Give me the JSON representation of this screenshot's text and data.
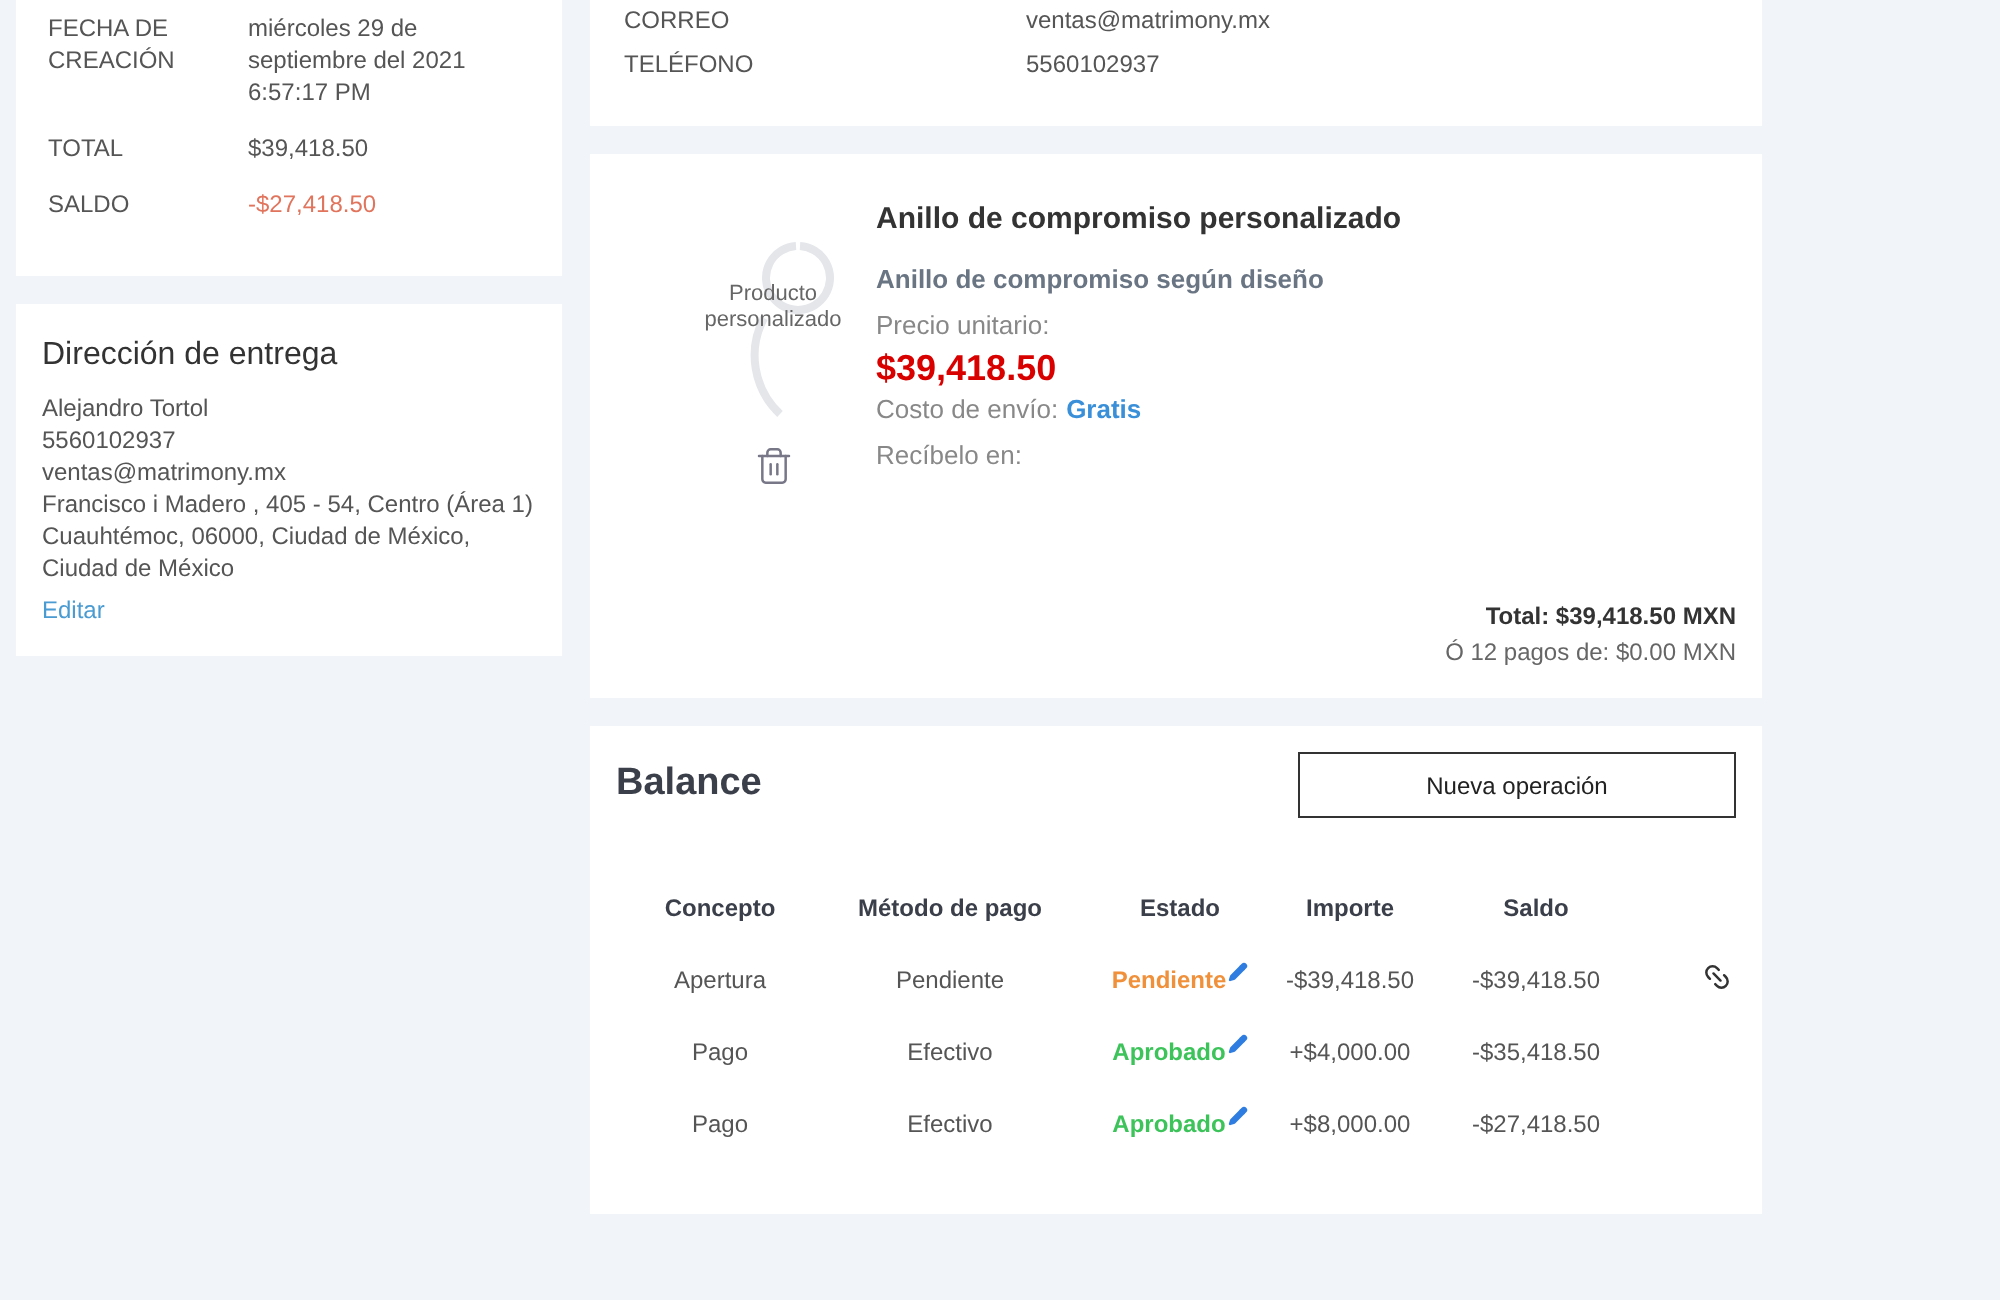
{
  "order_summary": {
    "rows": [
      {
        "label": "FECHA DE CREACIÓN",
        "value": "miércoles 29 de septiembre del 2021 6:57:17 PM",
        "kind": "normal"
      },
      {
        "label": "TOTAL",
        "value": "$39,418.50",
        "kind": "normal"
      },
      {
        "label": "SALDO",
        "value": "-$27,418.50",
        "kind": "negative"
      }
    ]
  },
  "contact": {
    "rows": [
      {
        "label": "CORREO",
        "value": "ventas@matrimony.mx"
      },
      {
        "label": "TELÉFONO",
        "value": "5560102937"
      }
    ]
  },
  "delivery": {
    "title": "Dirección de entrega",
    "lines": [
      "Alejandro Tortol",
      "5560102937",
      "ventas@matrimony.mx",
      "Francisco i Madero , 405 - 54, Centro (Área 1)",
      "Cuauhtémoc, 06000, Ciudad de México, Ciudad de México"
    ],
    "edit_link": "Editar"
  },
  "product": {
    "image_label": "Producto personalizado",
    "name": "Anillo de compromiso personalizado",
    "subtitle": "Anillo de compromiso según diseño",
    "price_label": "Precio unitario:",
    "price": "$39,418.50",
    "shipping_label": "Costo de envío:",
    "shipping_value": "Gratis",
    "receive_label": "Recíbelo en:",
    "total": "Total: $39,418.50 MXN",
    "installments": "Ó 12 pagos de: $0.00 MXN"
  },
  "balance": {
    "title": "Balance",
    "new_button": "Nueva operación",
    "columns": [
      "Concepto",
      "Método de pago",
      "Estado",
      "Importe",
      "Saldo"
    ],
    "rows": [
      {
        "concept": "Apertura",
        "method": "Pendiente",
        "status": "Pendiente",
        "color": "#f0903a",
        "amount": "-$39,418.50",
        "balance": "-$39,418.50",
        "linked": true
      },
      {
        "concept": "Pago",
        "method": "Efectivo",
        "status": "Aprobado",
        "color": "#3cc35a",
        "amount": "+$4,000.00",
        "balance": "-$35,418.50",
        "linked": false
      },
      {
        "concept": "Pago",
        "method": "Efectivo",
        "status": "Aprobado",
        "color": "#3cc35a",
        "amount": "+$8,000.00",
        "balance": "-$27,418.50",
        "linked": false
      }
    ]
  }
}
